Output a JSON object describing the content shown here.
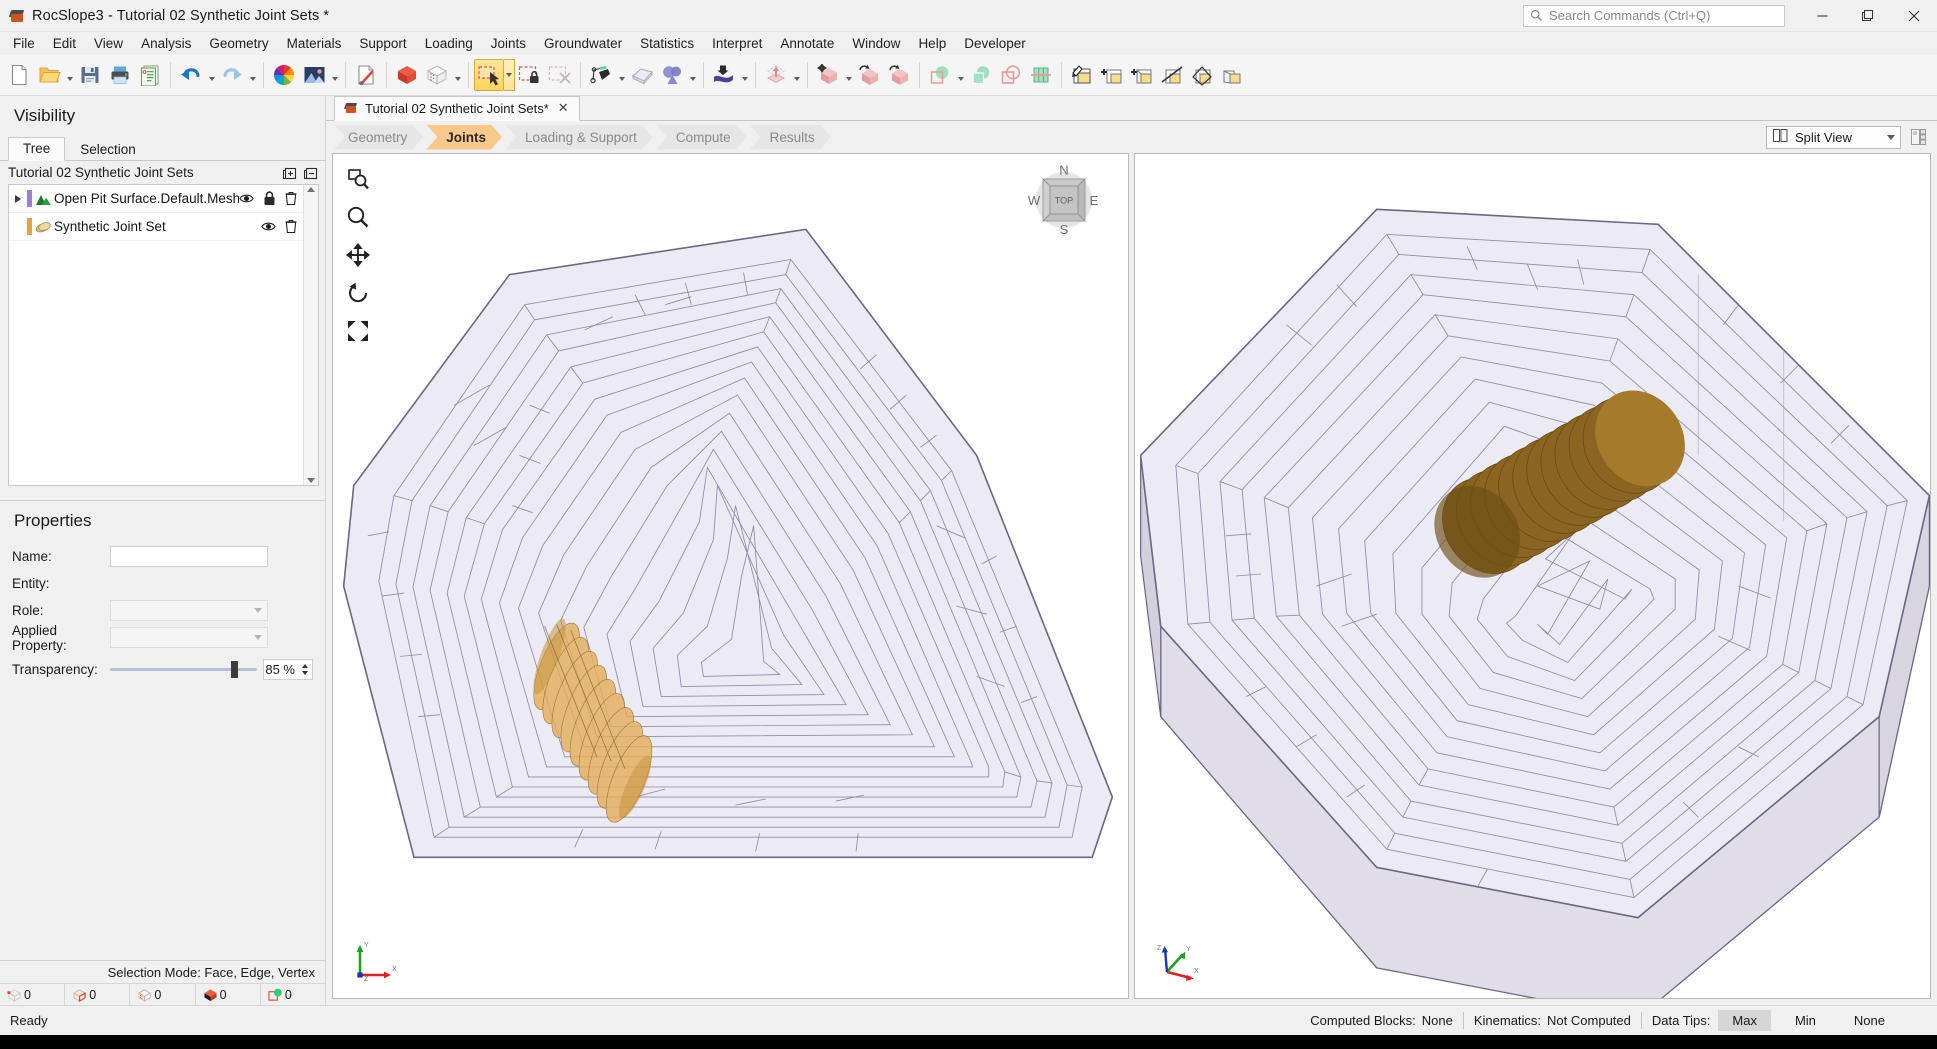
{
  "window": {
    "title": "RocSlope3 - Tutorial 02 Synthetic Joint Sets *",
    "app_icon": "rocslope-cube-icon",
    "minimize_label": "—",
    "maximize_label": "❐",
    "close_label": "✕"
  },
  "search": {
    "placeholder": "Search Commands (Ctrl+Q)",
    "icon": "search-icon"
  },
  "menu": {
    "items": [
      "File",
      "Edit",
      "View",
      "Analysis",
      "Geometry",
      "Materials",
      "Support",
      "Loading",
      "Joints",
      "Groundwater",
      "Statistics",
      "Interpret",
      "Annotate",
      "Window",
      "Help",
      "Developer"
    ]
  },
  "toolbar": {
    "groups": [
      {
        "buttons": [
          {
            "name": "new-file-button",
            "icon": "new-document-icon",
            "caret": false
          },
          {
            "name": "open-file-button",
            "icon": "open-folder-icon",
            "caret": true
          },
          {
            "name": "save-button",
            "icon": "floppy-disk-icon",
            "caret": false
          },
          {
            "name": "print-button",
            "icon": "printer-icon",
            "caret": false
          },
          {
            "name": "report-button",
            "icon": "report-document-icon",
            "caret": false
          }
        ]
      },
      {
        "buttons": [
          {
            "name": "undo-button",
            "icon": "undo-arrow-icon",
            "caret": true
          },
          {
            "name": "redo-button",
            "icon": "redo-arrow-icon",
            "caret": true
          }
        ]
      },
      {
        "buttons": [
          {
            "name": "color-wheel-button",
            "icon": "color-wheel-icon",
            "caret": false
          },
          {
            "name": "image-capture-button",
            "icon": "picture-icon",
            "caret": true
          }
        ]
      },
      {
        "buttons": [
          {
            "name": "edit-settings-button",
            "icon": "document-wrench-icon",
            "caret": false
          }
        ]
      },
      {
        "buttons": [
          {
            "name": "solid-view-button",
            "icon": "red-cube-icon",
            "caret": false
          },
          {
            "name": "mesh-view-button",
            "icon": "wireframe-cube-icon",
            "caret": true
          }
        ]
      },
      {
        "buttons": [
          {
            "name": "select-tool-button",
            "icon": "selection-arrow-icon",
            "caret": true,
            "active": true
          },
          {
            "name": "lock-selection-button",
            "icon": "selection-lock-icon",
            "caret": false
          },
          {
            "name": "clear-selection-button",
            "icon": "selection-clear-icon",
            "caret": false
          }
        ]
      },
      {
        "buttons": [
          {
            "name": "draw-polyline-button",
            "icon": "pen-polyline-icon",
            "caret": true
          },
          {
            "name": "surface-button",
            "icon": "surface-sheet-icon",
            "caret": false
          },
          {
            "name": "boolean-shapes-button",
            "icon": "overlapping-shapes-icon",
            "caret": true
          }
        ]
      },
      {
        "buttons": [
          {
            "name": "import-geometry-button",
            "icon": "import-fold-icon",
            "caret": true
          }
        ]
      },
      {
        "buttons": [
          {
            "name": "extrude-button",
            "icon": "extrude-up-icon",
            "caret": true
          }
        ]
      },
      {
        "buttons": [
          {
            "name": "move-button",
            "icon": "move-cube-icon",
            "caret": true
          },
          {
            "name": "rotate-button",
            "icon": "rotate-cube-icon",
            "caret": false
          },
          {
            "name": "mirror-button",
            "icon": "mirror-cube-icon",
            "caret": false
          }
        ]
      },
      {
        "buttons": [
          {
            "name": "boolean-subtract-button",
            "icon": "subtract-circles-icon",
            "caret": true
          },
          {
            "name": "boolean-intersect-button",
            "icon": "intersect-circles-icon",
            "caret": false
          },
          {
            "name": "boolean-union-button",
            "icon": "union-circles-icon",
            "caret": false
          },
          {
            "name": "grid-button",
            "icon": "green-grid-icon",
            "caret": false
          }
        ]
      },
      {
        "buttons": [
          {
            "name": "annotate-box-button",
            "icon": "pencil-box-icon",
            "caret": false
          },
          {
            "name": "add-box-button",
            "icon": "plus-box-icon",
            "caret": false
          },
          {
            "name": "add-volume-button",
            "icon": "plus-volume-icon",
            "caret": false
          },
          {
            "name": "cut-volume-button",
            "icon": "cut-volume-icon",
            "caret": false
          },
          {
            "name": "slice-volume-button",
            "icon": "slice-volume-icon",
            "caret": false
          },
          {
            "name": "merge-volume-button",
            "icon": "merge-volume-icon",
            "caret": false
          }
        ]
      }
    ]
  },
  "visibility": {
    "title": "Visibility",
    "tabs": [
      {
        "label": "Tree",
        "selected": true
      },
      {
        "label": "Selection",
        "selected": false
      }
    ],
    "tree_root_label": "Tutorial 02 Synthetic Joint Sets",
    "expand_all_icon": "expand-all-icon",
    "collapse_all_icon": "collapse-all-icon",
    "rows": [
      {
        "label": "Open Pit Surface.Default.Mesh_rep",
        "expandable": true,
        "swatch_color": "#9b7fd4",
        "icon": "terrain-mountain-icon",
        "actions": [
          "eye-icon",
          "lock-icon",
          "trash-icon"
        ]
      },
      {
        "label": "Synthetic Joint Set",
        "expandable": false,
        "swatch_color": "#e8a33d",
        "icon": "joint-disc-icon",
        "actions": [
          "eye-icon",
          "trash-icon"
        ]
      }
    ]
  },
  "properties": {
    "title": "Properties",
    "fields": [
      {
        "label": "Name:",
        "value": "",
        "type": "text"
      },
      {
        "label": "Entity:",
        "value": "",
        "type": "static"
      },
      {
        "label": "Role:",
        "value": "",
        "type": "combo"
      },
      {
        "label": "Applied Property:",
        "value": "",
        "type": "combo"
      }
    ],
    "transparency": {
      "label": "Transparency:",
      "value": "85 %",
      "percent": 85
    }
  },
  "left_status": {
    "selection_mode": "Selection Mode:  Face, Edge, Vertex",
    "counters": [
      {
        "icon": "vertex-count-icon",
        "value": "0"
      },
      {
        "icon": "edge-count-icon",
        "value": "0"
      },
      {
        "icon": "face-count-icon",
        "value": "0"
      },
      {
        "icon": "block-count-icon",
        "value": "0"
      },
      {
        "icon": "selected-count-icon",
        "value": "0"
      }
    ]
  },
  "document_tab": {
    "label": "Tutorial 02 Synthetic Joint Sets*",
    "icon": "rocslope-cube-icon",
    "close_label": "✕"
  },
  "workflow": {
    "steps": [
      {
        "label": "Geometry",
        "active": false
      },
      {
        "label": "Joints",
        "active": true
      },
      {
        "label": "Loading & Support",
        "active": false
      },
      {
        "label": "Compute",
        "active": false
      },
      {
        "label": "Results",
        "active": false
      }
    ]
  },
  "view_controls": {
    "split_view_label": "Split View",
    "split_view_icon": "split-view-icon",
    "layout_button_icon": "layout-panels-icon",
    "nav_tools": [
      "zoom-window-icon",
      "zoom-icon",
      "pan-icon",
      "rotate-icon",
      "zoom-all-icon"
    ]
  },
  "viewport_left": {
    "compass": {
      "cube_face_label": "TOP",
      "north": "N",
      "east": "E",
      "south": "S",
      "west": "W"
    },
    "axis_triad": {
      "x": "X",
      "y": "Y",
      "z": "Z"
    }
  },
  "viewport_right": {
    "axis_triad": {
      "x": "X",
      "y": "Y",
      "z": "Z"
    }
  },
  "colors": {
    "joint_orange": "#d79a3c",
    "joint_orange_dark": "#8a6420",
    "mesh_purple": "#8b86ab",
    "terrain_fill": "#eceaf2",
    "accent_active_tab": "#f8c98b"
  },
  "statusbar": {
    "ready_text": "Ready",
    "computed_blocks_label": "Computed Blocks:",
    "computed_blocks_value": "None",
    "kinematics_label": "Kinematics:",
    "kinematics_value": "Not Computed",
    "data_tips_label": "Data Tips:",
    "data_tips_options": [
      {
        "label": "Max",
        "selected": true
      },
      {
        "label": "Min",
        "selected": false
      },
      {
        "label": "None",
        "selected": false
      }
    ]
  }
}
